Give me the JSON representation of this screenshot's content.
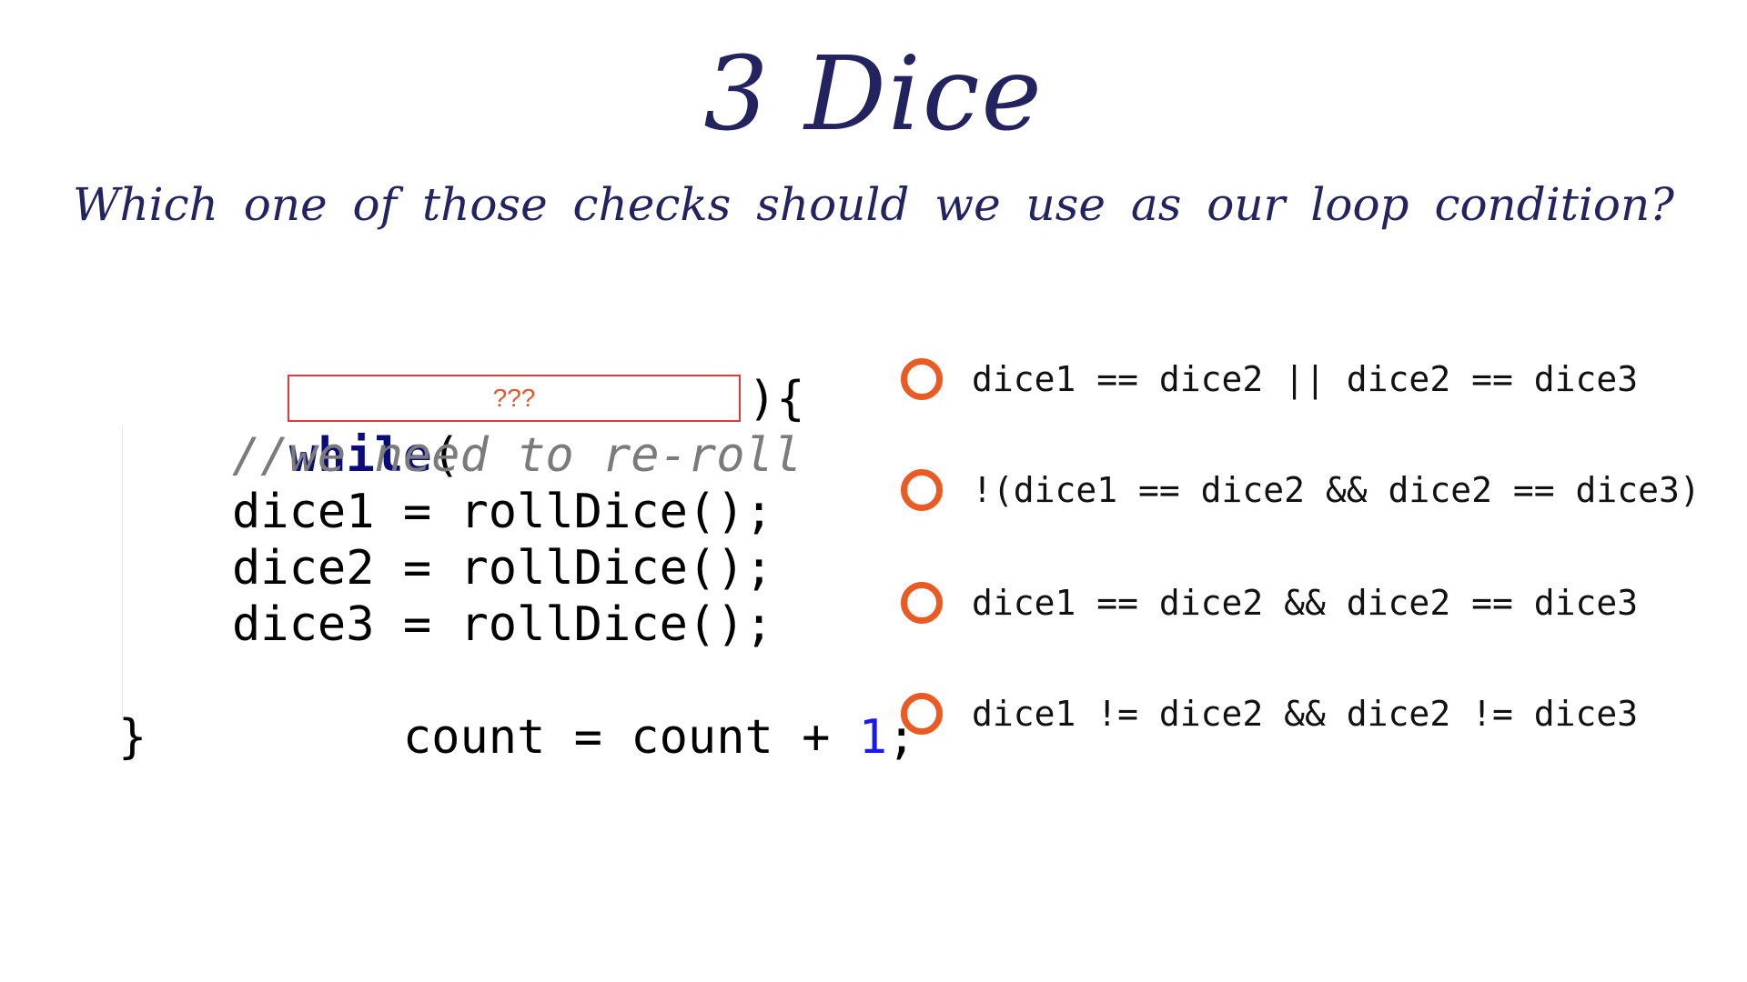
{
  "slide": {
    "title": "3 Dice",
    "question": "Which one of those checks should we use as our loop condition?"
  },
  "code": {
    "while_keyword": "while",
    "open_paren": "(",
    "blank_placeholder": "???",
    "close_brace_open": "){",
    "comment": "//we need to re-roll",
    "line_dice1": "dice1 = rollDice();",
    "line_dice2": "dice2 = rollDice();",
    "line_dice3": "dice3 = rollDice();",
    "line_count_prefix": "count = count + ",
    "line_count_number": "1",
    "line_count_suffix": ";",
    "closing_brace": "}"
  },
  "options": [
    {
      "text": "dice1 == dice2 || dice2 == dice3"
    },
    {
      "text": "!(dice1 == dice2 && dice2 == dice3)"
    },
    {
      "text": "dice1 == dice2 && dice2 == dice3"
    },
    {
      "text": "dice1 != dice2 && dice2 != dice3"
    }
  ],
  "colors": {
    "title": "#23235f",
    "radio_outline": "#ec5a24",
    "blank_border": "#e23a3a",
    "keyword": "#0b0b7a",
    "number": "#1a1af0",
    "comment": "#7b7b7b"
  },
  "icons": {
    "radio": "radio-button-unselected-icon"
  }
}
